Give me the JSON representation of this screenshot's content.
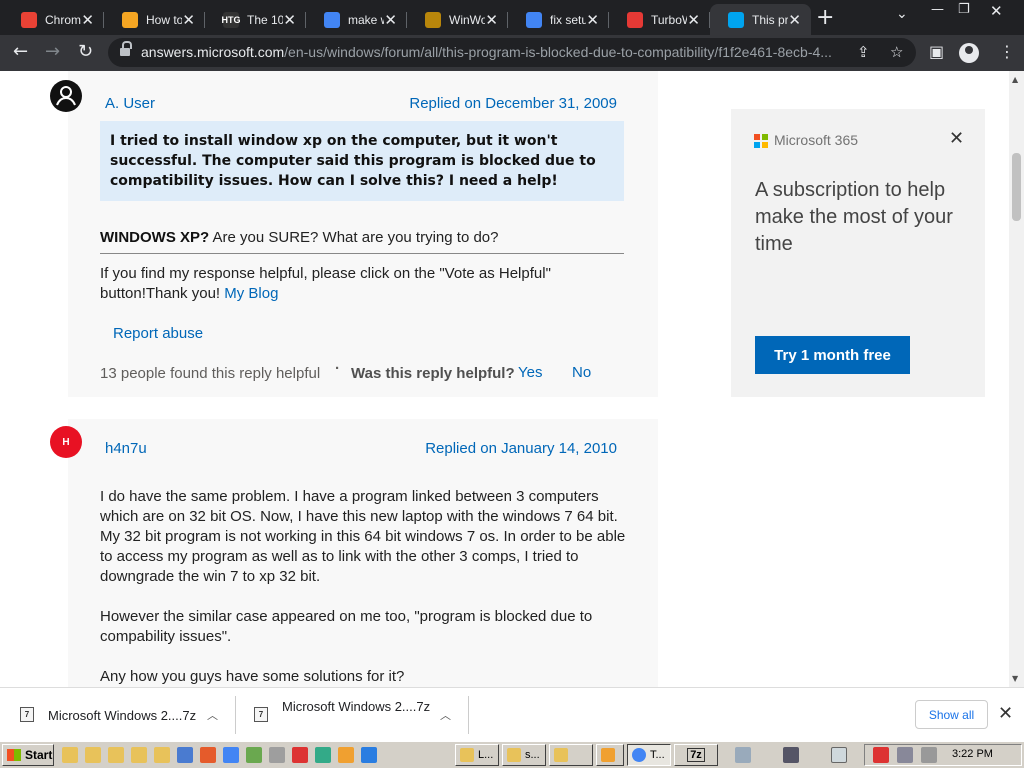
{
  "browser": {
    "tabs": [
      {
        "title": "Chrome",
        "favicon": "chrome-web-store-icon",
        "color": "#e94235"
      },
      {
        "title": "How to",
        "favicon": "howto-site-icon",
        "color": "#f5a623"
      },
      {
        "title": "The 10",
        "favicon": "htg-icon",
        "color": "#333333",
        "badge": "HTG"
      },
      {
        "title": "make w",
        "favicon": "google-icon",
        "color": "#4285f4"
      },
      {
        "title": "WinWo",
        "favicon": "winworld-icon",
        "color": "#b8860b"
      },
      {
        "title": "fix setu",
        "favicon": "google-icon",
        "color": "#4285f4"
      },
      {
        "title": "TurboW",
        "favicon": "turbo-icon",
        "color": "#e53935"
      },
      {
        "title": "This pr",
        "favicon": "microsoft-icon",
        "color": "#00a4ef",
        "active": true
      }
    ],
    "url_host": "answers.microsoft.com",
    "url_path": "/en-us/windows/forum/all/this-program-is-blocked-due-to-compatibility/f1f2e461-8ecb-4..."
  },
  "thread": {
    "reply1": {
      "user": "A. User",
      "replied": "Replied on December 31, 2009",
      "quote": "I tried to install window xp on the computer, but it won't successful. The computer said this program is blocked due to compatibility issues. How can I solve this? I need a help!",
      "body_bold": "WINDOWS XP?",
      "body_rest": " Are you SURE? What are you trying to do?",
      "sig": "If you find my response helpful, please click on the \"Vote as Helpful\" button!Thank you! ",
      "sig_link": "My Blog",
      "report": "Report abuse",
      "helpful_count": "13 people found this reply helpful",
      "helpful_q": "Was this reply helpful?",
      "yes": "Yes",
      "no": "No"
    },
    "reply2": {
      "initial": "H",
      "user": "h4n7u",
      "replied": "Replied on January 14, 2010",
      "p1": "I do have the same problem. I have a program linked between 3 computers which are on 32 bit OS. Now, I have this new laptop with the windows 7 64 bit. My 32 bit program is not working in this 64 bit windows 7 os. In order to be able to access my program as well as to link with the other 3 comps, I tried to downgrade the win 7 to xp 32 bit.",
      "p2": "However the similar case appeared on me too, \"program is blocked due to compability issues\".",
      "p3": "Any how you guys have some solutions for it?"
    }
  },
  "ad": {
    "brand": "Microsoft 365",
    "headline": "A subscription to help make the most of your time",
    "cta": "Try 1 month free"
  },
  "downloads": {
    "items": [
      {
        "name": "Microsoft Windows 2....7z"
      },
      {
        "name": "Microsoft Windows 2....7z"
      }
    ],
    "show_all": "Show all"
  },
  "taskbar": {
    "start": "Start",
    "buttons": [
      {
        "label": "L..."
      },
      {
        "label": "s..."
      },
      {
        "label": ""
      },
      {
        "label": ""
      },
      {
        "label": "T..."
      },
      {
        "label": "7z"
      }
    ],
    "clock": "3:22 PM"
  }
}
